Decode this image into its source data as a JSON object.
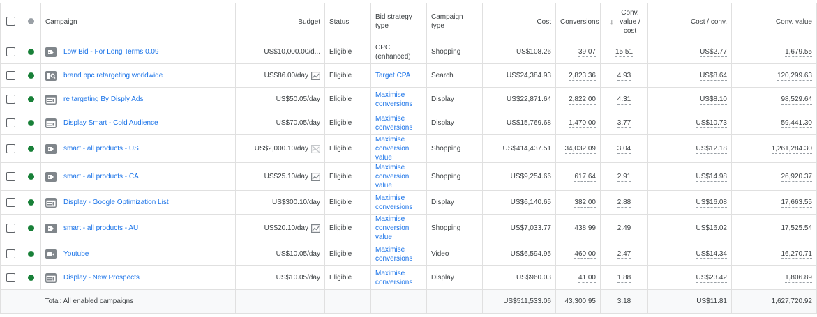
{
  "columns": {
    "campaign": "Campaign",
    "budget": "Budget",
    "status": "Status",
    "bid_strategy": "Bid strategy type",
    "campaign_type": "Campaign type",
    "cost": "Cost",
    "conversions": "Conversions",
    "conv_value_cost": "Conv. value / cost",
    "cost_per_conv": "Cost / conv.",
    "conv_value": "Conv. value"
  },
  "rows": [
    {
      "icon": "shopping-tag-icon",
      "campaign": "Low Bid - For Long Terms 0.09",
      "budget": "US$10,000.00/d...",
      "budget_icon": "",
      "status": "Eligible",
      "bid_strategy": "CPC (enhanced)",
      "bid_link": false,
      "campaign_type": "Shopping",
      "cost": "US$108.26",
      "conversions": "39.07",
      "conv_value_cost": "15.51",
      "cost_per_conv": "US$2.77",
      "conv_value": "1,679.55"
    },
    {
      "icon": "search-campaign-icon",
      "campaign": "brand ppc retargeting worldwide",
      "budget": "US$86.00/day",
      "budget_icon": "trend-chart-icon",
      "status": "Eligible",
      "bid_strategy": "Target CPA",
      "bid_link": true,
      "campaign_type": "Search",
      "cost": "US$24,384.93",
      "conversions": "2,823.36",
      "conv_value_cost": "4.93",
      "cost_per_conv": "US$8.64",
      "conv_value": "120,299.63"
    },
    {
      "icon": "display-campaign-icon",
      "campaign": "re targeting By Disply Ads",
      "budget": "US$50.05/day",
      "budget_icon": "",
      "status": "Eligible",
      "bid_strategy": "Maximise conversions",
      "bid_link": true,
      "campaign_type": "Display",
      "cost": "US$22,871.64",
      "conversions": "2,822.00",
      "conv_value_cost": "4.31",
      "cost_per_conv": "US$8.10",
      "conv_value": "98,529.64"
    },
    {
      "icon": "display-campaign-icon",
      "campaign": "Display Smart - Cold Audience",
      "budget": "US$70.05/day",
      "budget_icon": "",
      "status": "Eligible",
      "bid_strategy": "Maximise conversions",
      "bid_link": true,
      "campaign_type": "Display",
      "cost": "US$15,769.68",
      "conversions": "1,470.00",
      "conv_value_cost": "3.77",
      "cost_per_conv": "US$10.73",
      "conv_value": "59,441.30"
    },
    {
      "icon": "shopping-tag-icon",
      "campaign": "smart - all products - US",
      "budget": "US$2,000.10/day",
      "budget_icon": "trend-chart-disabled-icon",
      "status": "Eligible",
      "bid_strategy": "Maximise conversion value",
      "bid_link": true,
      "campaign_type": "Shopping",
      "cost": "US$414,437.51",
      "conversions": "34,032.09",
      "conv_value_cost": "3.04",
      "cost_per_conv": "US$12.18",
      "conv_value": "1,261,284.30",
      "tall": true
    },
    {
      "icon": "shopping-tag-icon",
      "campaign": "smart - all products - CA",
      "budget": "US$25.10/day",
      "budget_icon": "trend-chart-icon",
      "status": "Eligible",
      "bid_strategy": "Maximise conversion value",
      "bid_link": true,
      "campaign_type": "Shopping",
      "cost": "US$9,254.66",
      "conversions": "617.64",
      "conv_value_cost": "2.91",
      "cost_per_conv": "US$14.98",
      "conv_value": "26,920.37",
      "tall": true
    },
    {
      "icon": "display-campaign-icon",
      "campaign": "Display - Google Optimization List",
      "budget": "US$300.10/day",
      "budget_icon": "",
      "status": "Eligible",
      "bid_strategy": "Maximise conversions",
      "bid_link": true,
      "campaign_type": "Display",
      "cost": "US$6,140.65",
      "conversions": "382.00",
      "conv_value_cost": "2.88",
      "cost_per_conv": "US$16.08",
      "conv_value": "17,663.55"
    },
    {
      "icon": "shopping-tag-icon",
      "campaign": "smart - all products - AU",
      "budget": "US$20.10/day",
      "budget_icon": "trend-chart-icon",
      "status": "Eligible",
      "bid_strategy": "Maximise conversion value",
      "bid_link": true,
      "campaign_type": "Shopping",
      "cost": "US$7,033.77",
      "conversions": "438.99",
      "conv_value_cost": "2.49",
      "cost_per_conv": "US$16.02",
      "conv_value": "17,525.54",
      "tall": true
    },
    {
      "icon": "video-campaign-icon",
      "campaign": "Youtube",
      "budget": "US$10.05/day",
      "budget_icon": "",
      "status": "Eligible",
      "bid_strategy": "Maximise conversions",
      "bid_link": true,
      "campaign_type": "Video",
      "cost": "US$6,594.95",
      "conversions": "460.00",
      "conv_value_cost": "2.47",
      "cost_per_conv": "US$14.34",
      "conv_value": "16,270.71"
    },
    {
      "icon": "display-campaign-icon",
      "campaign": "Display - New Prospects",
      "budget": "US$10.05/day",
      "budget_icon": "",
      "status": "Eligible",
      "bid_strategy": "Maximise conversions",
      "bid_link": true,
      "campaign_type": "Display",
      "cost": "US$960.03",
      "conversions": "41.00",
      "conv_value_cost": "1.88",
      "cost_per_conv": "US$23.42",
      "conv_value": "1,806.89"
    }
  ],
  "total": {
    "label": "Total: All enabled campaigns",
    "cost": "US$511,533.06",
    "conversions": "43,300.95",
    "conv_value_cost": "3.18",
    "cost_per_conv": "US$11.81",
    "conv_value": "1,627,720.92"
  },
  "colors": {
    "link": "#1a73e8",
    "enabled_dot": "#188038",
    "icon_grey": "#80868b"
  }
}
